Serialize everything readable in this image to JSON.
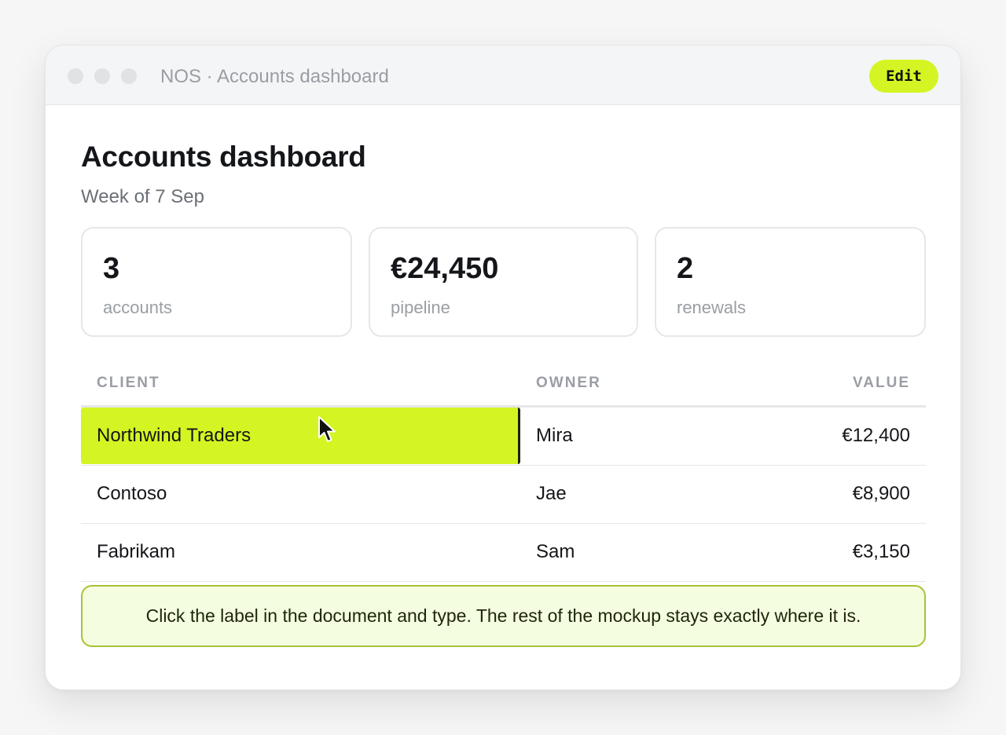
{
  "window": {
    "title": "NOS · Accounts dashboard",
    "edit_label": "Edit"
  },
  "page": {
    "title": "Accounts dashboard",
    "subtitle": "Week of 7 Sep"
  },
  "stats": [
    {
      "value": "3",
      "label": "accounts"
    },
    {
      "value": "€24,450",
      "label": "pipeline"
    },
    {
      "value": "2",
      "label": "renewals"
    }
  ],
  "table": {
    "headers": {
      "client": "CLIENT",
      "owner": "OWNER",
      "value": "VALUE"
    },
    "rows": [
      {
        "client": "Northwind Traders",
        "owner": "Mira",
        "value": "€12,400",
        "selected": true
      },
      {
        "client": "Contoso",
        "owner": "Jae",
        "value": "€8,900",
        "selected": false
      },
      {
        "client": "Fabrikam",
        "owner": "Sam",
        "value": "€3,150",
        "selected": false
      }
    ]
  },
  "note": "Click the label in the document and type. The rest of the mockup stays exactly where it is.",
  "colors": {
    "accent": "#d4f523",
    "note_background": "#f5fde0",
    "note_border": "#a7c23a"
  },
  "icons": {
    "window_controls": [
      "window-dot-icon",
      "window-dot-icon",
      "window-dot-icon"
    ],
    "pointer": "mouse-pointer-icon"
  }
}
